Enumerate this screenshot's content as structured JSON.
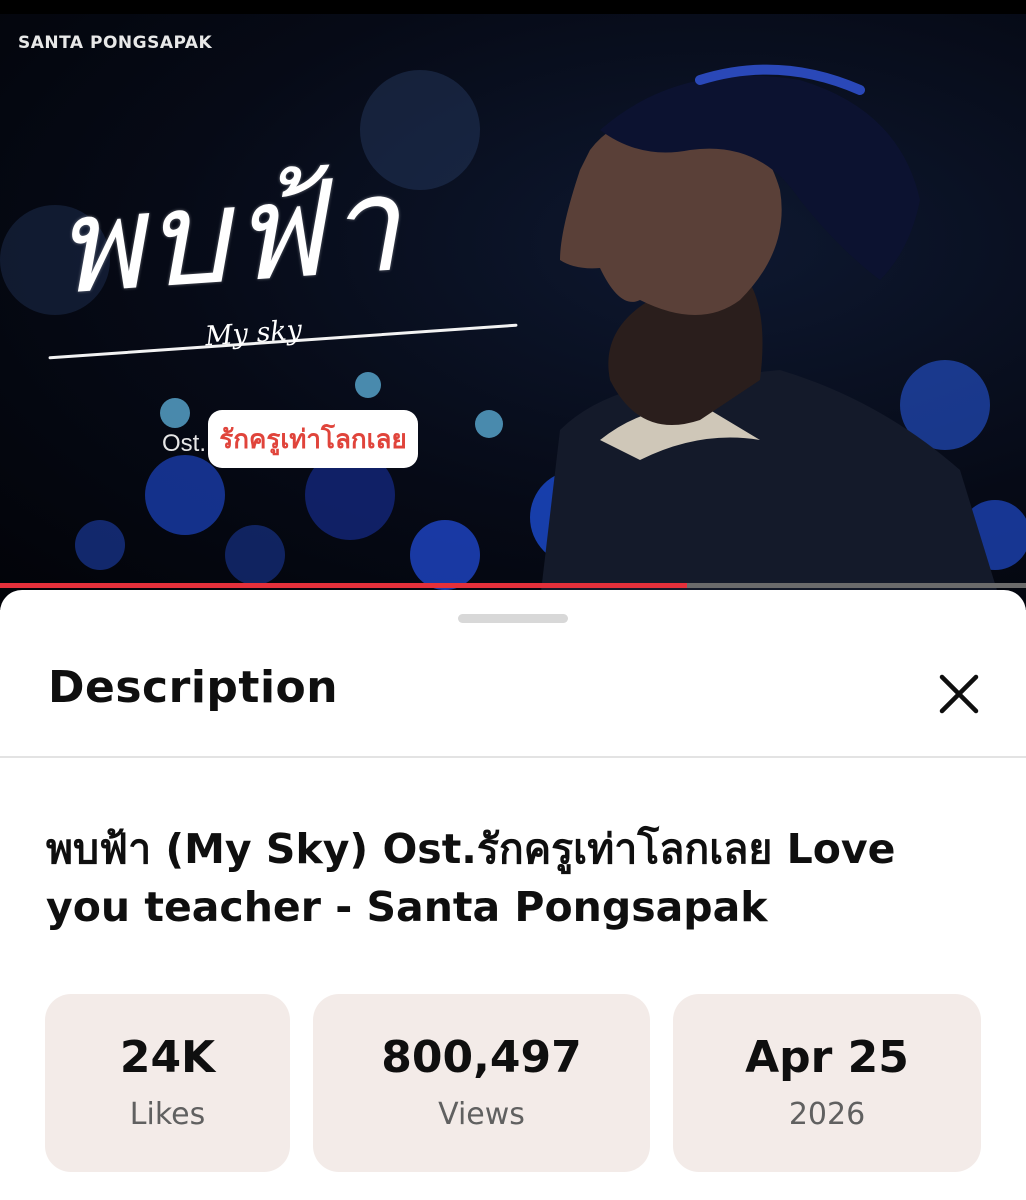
{
  "video": {
    "channel_label": "SANTA PONGSAPAK",
    "title_art_text": "พบฟ้า",
    "subtitle_art_text": "My sky",
    "ost_prefix": "Ost.",
    "ost_logo_text": "รักครูเท่าโลกเลย",
    "progress": 0.67,
    "colors": {
      "progress": "#e5303b",
      "track": "#6b6b6b"
    }
  },
  "sheet": {
    "header_title": "Description",
    "close_icon": "close-icon",
    "video_title": "พบฟ้า (My Sky) Ost.รักครูเท่าโลกเลย Love you teacher - Santa Pongsapak",
    "stats": [
      {
        "value": "24K",
        "label": "Likes"
      },
      {
        "value": "800,497",
        "label": "Views"
      },
      {
        "value": "Apr 25",
        "label": "2026"
      }
    ],
    "colors": {
      "stat_background": "#f3ebe8"
    }
  }
}
